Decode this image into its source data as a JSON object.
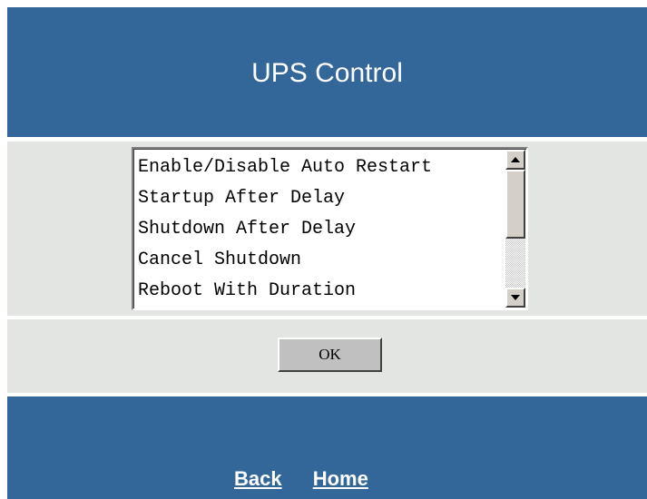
{
  "header": {
    "title": "UPS Control"
  },
  "control_list": {
    "items": [
      "Enable/Disable Auto Restart",
      "Startup After Delay",
      "Shutdown After Delay",
      "Cancel Shutdown",
      "Reboot With Duration"
    ]
  },
  "actions": {
    "ok_label": "OK"
  },
  "footer": {
    "links": [
      "Back",
      "Home"
    ]
  },
  "colors": {
    "header_bg": "#336699",
    "panel_bg": "#e2e5e2",
    "link_text": "#ffffff"
  }
}
